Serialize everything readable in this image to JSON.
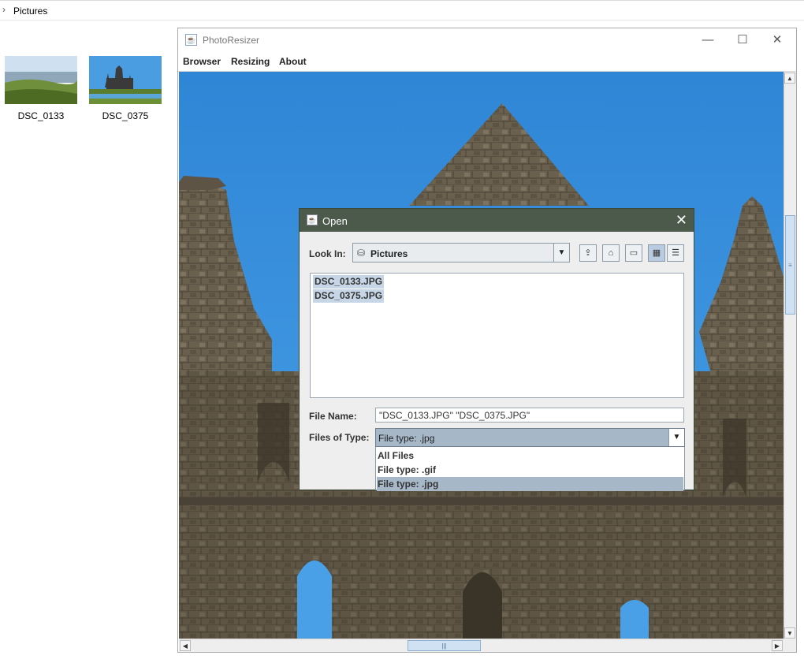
{
  "explorer": {
    "breadcrumb": "Pictures",
    "files": [
      {
        "name": "DSC_0133"
      },
      {
        "name": "DSC_0375"
      }
    ]
  },
  "app": {
    "title": "PhotoResizer",
    "menu": [
      "Browser",
      "Resizing",
      "About"
    ]
  },
  "dialog": {
    "title": "Open",
    "look_in_label": "Look In:",
    "look_in_value": "Pictures",
    "files": [
      "DSC_0133.JPG",
      "DSC_0375.JPG"
    ],
    "file_name_label": "File Name:",
    "file_name_value": "\"DSC_0133.JPG\" \"DSC_0375.JPG\"",
    "file_type_label": "Files of Type:",
    "file_type_value": "File type: .jpg",
    "file_type_options": [
      "All Files",
      "File type: .gif",
      "File type: .jpg"
    ],
    "selected_option_index": 2
  },
  "colors": {
    "sky": "#3d93dd",
    "stone": "#6e6350",
    "dialog_title_bar": "#4b5a4b",
    "selection": "#a6b7c8"
  }
}
